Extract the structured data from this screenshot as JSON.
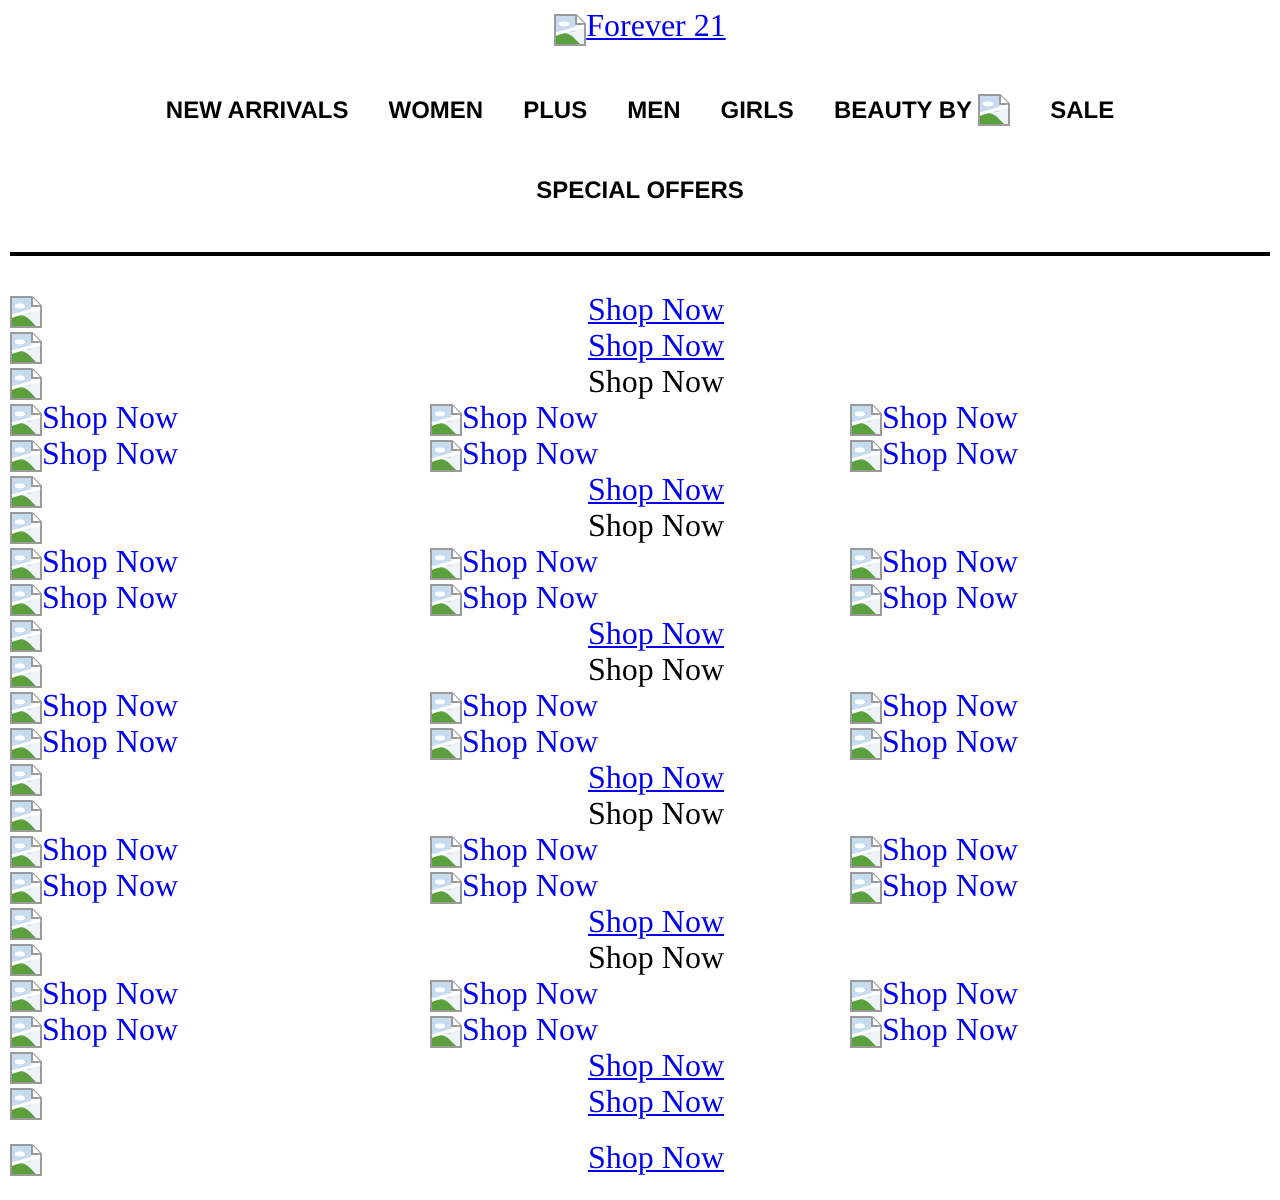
{
  "header": {
    "logo_text": "Forever 21"
  },
  "nav": [
    {
      "label": "NEW ARRIVALS",
      "kind": "text"
    },
    {
      "label": "WOMEN",
      "kind": "text"
    },
    {
      "label": "PLUS",
      "kind": "text"
    },
    {
      "label": "MEN",
      "kind": "text"
    },
    {
      "label": "GIRLS",
      "kind": "text"
    },
    {
      "label": "BEAUTY BY",
      "kind": "with_image"
    },
    {
      "label": "SALE",
      "kind": "text"
    },
    {
      "label": "SPECIAL OFFERS",
      "kind": "text"
    }
  ],
  "rows": [
    {
      "kind": "banner",
      "label": "Shop Now",
      "link": true
    },
    {
      "kind": "banner",
      "label": "Shop Now",
      "link": true
    },
    {
      "kind": "banner",
      "label": "Shop Now",
      "link": false
    },
    {
      "kind": "grid",
      "items": [
        "Shop Now",
        "Shop Now",
        "Shop Now"
      ]
    },
    {
      "kind": "grid",
      "items": [
        "Shop Now",
        "Shop Now",
        "Shop Now"
      ]
    },
    {
      "kind": "banner",
      "label": "Shop Now",
      "link": true
    },
    {
      "kind": "banner",
      "label": "Shop Now",
      "link": false
    },
    {
      "kind": "grid",
      "items": [
        "Shop Now",
        "Shop Now",
        "Shop Now"
      ]
    },
    {
      "kind": "grid",
      "items": [
        "Shop Now",
        "Shop Now",
        "Shop Now"
      ]
    },
    {
      "kind": "banner",
      "label": "Shop Now",
      "link": true
    },
    {
      "kind": "banner",
      "label": "Shop Now",
      "link": false
    },
    {
      "kind": "grid",
      "items": [
        "Shop Now",
        "Shop Now",
        "Shop Now"
      ]
    },
    {
      "kind": "grid",
      "items": [
        "Shop Now",
        "Shop Now",
        "Shop Now"
      ]
    },
    {
      "kind": "banner",
      "label": "Shop Now",
      "link": true
    },
    {
      "kind": "banner",
      "label": "Shop Now",
      "link": false
    },
    {
      "kind": "grid",
      "items": [
        "Shop Now",
        "Shop Now",
        "Shop Now"
      ]
    },
    {
      "kind": "grid",
      "items": [
        "Shop Now",
        "Shop Now",
        "Shop Now"
      ]
    },
    {
      "kind": "banner",
      "label": "Shop Now",
      "link": true
    },
    {
      "kind": "banner",
      "label": "Shop Now",
      "link": false
    },
    {
      "kind": "grid",
      "items": [
        "Shop Now",
        "Shop Now",
        "Shop Now"
      ]
    },
    {
      "kind": "grid",
      "items": [
        "Shop Now",
        "Shop Now",
        "Shop Now"
      ]
    },
    {
      "kind": "banner",
      "label": "Shop Now",
      "link": true
    },
    {
      "kind": "banner",
      "label": "Shop Now",
      "link": true
    }
  ],
  "footer_row": {
    "label": "Shop Now",
    "link": true
  }
}
